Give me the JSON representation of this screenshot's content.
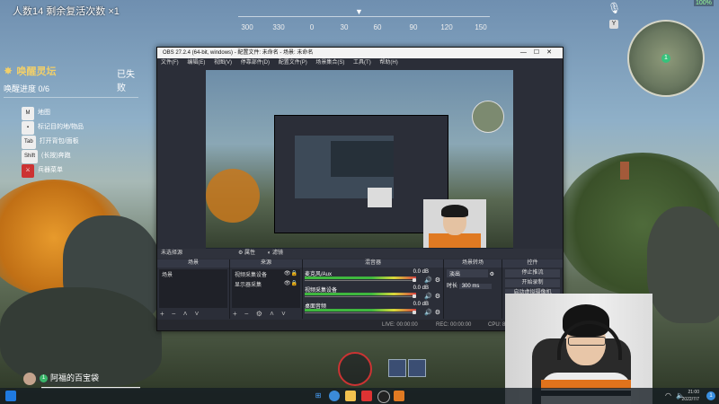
{
  "game": {
    "top_text": "人数14  剩余复活次数 ×1",
    "compass_ticks": [
      "300",
      "330",
      "0",
      "30",
      "60",
      "90",
      "120",
      "150"
    ],
    "compass_marker": "▼",
    "quest_title": "唤醒灵坛",
    "quest_progress": "唤醒进度 0/6",
    "quest_status": "已失败",
    "keybinds": [
      {
        "key": "M",
        "label": "地图"
      },
      {
        "key": "",
        "label": "标记目的地/物品"
      },
      {
        "key": "Tab",
        "label": "打开背包/面板"
      },
      {
        "key": "Shift",
        "label": "(长按)奔跑"
      },
      {
        "key": "",
        "label": "兵器菜单"
      }
    ],
    "y_button": "Y",
    "player_name": "阿福的百宝袋",
    "player_level": "1",
    "minimap_pin": "1",
    "battery_label": "100%"
  },
  "obs": {
    "title": "OBS 27.2.4 (64-bit, windows) - 配置文件: 未命名 - 场景: 未命名",
    "window_controls": [
      "—",
      "☐",
      "✕"
    ],
    "menu": [
      "文件(F)",
      "编辑(E)",
      "视图(V)",
      "停靠部件(D)",
      "配置文件(P)",
      "场景集合(S)",
      "工具(T)",
      "帮助(H)"
    ],
    "selected_source_label": "未选择源",
    "toolbar_buttons": [
      "属性",
      "滤镜"
    ],
    "docks": {
      "scenes": {
        "header": "场景",
        "items": [
          "场景"
        ],
        "footer": "+ − ˄ ˅"
      },
      "sources": {
        "header": "来源",
        "items": [
          "视频采集设备",
          "显示器采集"
        ],
        "footer": "+ − ⚙ ˄ ˅"
      },
      "mixer": {
        "header": "混音器",
        "channels": [
          {
            "name": "麦克风/Aux",
            "db": "0.0 dB"
          },
          {
            "name": "视频采集设备",
            "db": "0.0 dB"
          },
          {
            "name": "桌面音频",
            "db": "0.0 dB"
          }
        ]
      },
      "transitions": {
        "header": "场景转场",
        "type": "淡出",
        "duration_label": "时长",
        "duration_value": "300 ms"
      },
      "controls": {
        "header": "控件",
        "buttons": [
          "停止推流",
          "开始录制",
          "启动虚拟摄像机"
        ]
      }
    },
    "status": {
      "live": "LIVE: 00:00:00",
      "rec": "REC: 00:00:00",
      "cpu": "CPU: 8.8%, 30.00 fps"
    }
  },
  "taskbar": {
    "time": "21:00",
    "date": "2022/7/7",
    "notification_count": "1"
  },
  "colors": {
    "quest_gold": "#f1cf6a",
    "obs_bg": "#2b2e38",
    "meter_green": "#3fb83f",
    "shirt_orange": "#e1731c"
  }
}
